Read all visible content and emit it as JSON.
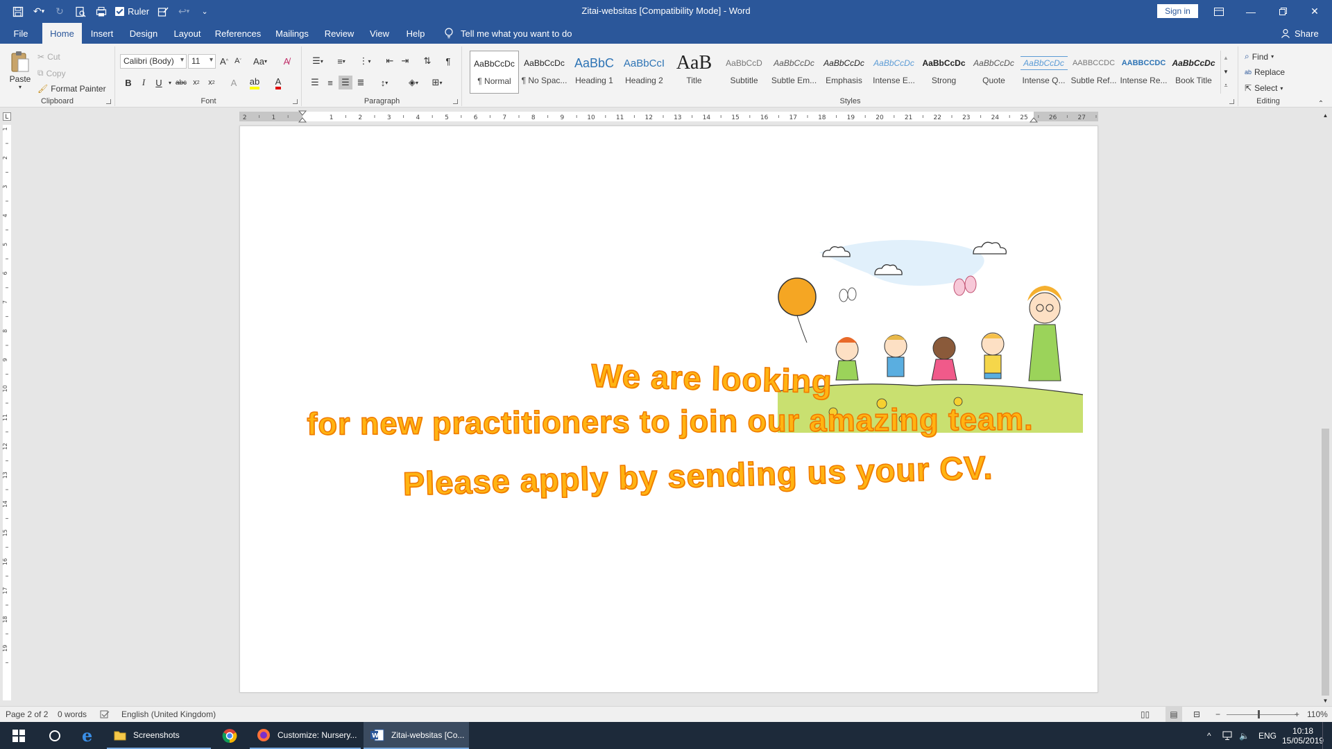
{
  "window": {
    "title": "Zitai-websitas [Compatibility Mode]  -  Word",
    "signin_label": "Sign in",
    "ruler_label": "Ruler"
  },
  "tabs": [
    {
      "label": "File"
    },
    {
      "label": "Home"
    },
    {
      "label": "Insert"
    },
    {
      "label": "Design"
    },
    {
      "label": "Layout"
    },
    {
      "label": "References"
    },
    {
      "label": "Mailings"
    },
    {
      "label": "Review"
    },
    {
      "label": "View"
    },
    {
      "label": "Help"
    }
  ],
  "tell_me": "Tell me what you want to do",
  "share_label": "Share",
  "clipboard": {
    "paste": "Paste",
    "cut": "Cut",
    "copy": "Copy",
    "format_painter": "Format Painter",
    "label": "Clipboard"
  },
  "font": {
    "name": "Calibri (Body)",
    "size": "11",
    "label": "Font",
    "case": "Aa"
  },
  "paragraph": {
    "label": "Paragraph"
  },
  "styles": {
    "label": "Styles",
    "items": [
      {
        "preview": "AaBbCcDc",
        "name": "¶ Normal"
      },
      {
        "preview": "AaBbCcDc",
        "name": "¶ No Spac..."
      },
      {
        "preview": "AaBbC",
        "name": "Heading 1"
      },
      {
        "preview": "AaBbCcI",
        "name": "Heading 2"
      },
      {
        "preview": "AaB",
        "name": "Title"
      },
      {
        "preview": "AaBbCcD",
        "name": "Subtitle"
      },
      {
        "preview": "AaBbCcDc",
        "name": "Subtle Em..."
      },
      {
        "preview": "AaBbCcDc",
        "name": "Emphasis"
      },
      {
        "preview": "AaBbCcDc",
        "name": "Intense E..."
      },
      {
        "preview": "AaBbCcDc",
        "name": "Strong"
      },
      {
        "preview": "AaBbCcDc",
        "name": "Quote"
      },
      {
        "preview": "AaBbCcDc",
        "name": "Intense Q..."
      },
      {
        "preview": "AaBbCcDc",
        "name": "Subtle Ref..."
      },
      {
        "preview": "AaBbCcDc",
        "name": "Intense Re..."
      },
      {
        "preview": "AaBbCcDc",
        "name": "Book Title"
      }
    ]
  },
  "editing": {
    "label": "Editing",
    "find": "Find",
    "replace": "Replace",
    "select": "Select"
  },
  "ruler_numbers": [
    "2",
    "1",
    "1",
    "2",
    "3",
    "4",
    "5",
    "6",
    "7",
    "8",
    "9",
    "10",
    "11",
    "12",
    "13",
    "14",
    "15",
    "16",
    "17",
    "18",
    "19",
    "20",
    "21",
    "22",
    "23",
    "24",
    "25",
    "26",
    "27"
  ],
  "vruler_numbers": [
    "1",
    "2",
    "3",
    "4",
    "5",
    "6",
    "7",
    "8",
    "9",
    "10",
    "11",
    "12",
    "13",
    "14",
    "15",
    "16",
    "17",
    "18",
    "19"
  ],
  "document": {
    "line1": "We are looking",
    "line2": "for new practitioners to join our amazing team.",
    "line3": "Please apply by sending us your CV."
  },
  "status": {
    "page": "Page 2 of 2",
    "words": "0 words",
    "language": "English (United Kingdom)",
    "zoom": "110%"
  },
  "taskbar": {
    "apps": [
      {
        "label": "Screenshots"
      },
      {
        "label": "Customize: Nursery..."
      },
      {
        "label": "Zitai-websitas [Co..."
      }
    ],
    "lang": "ENG",
    "time": "10:18",
    "date": "15/05/2019"
  },
  "colors": {
    "brand": "#2b579a",
    "wordart_fill": "#ffb412",
    "wordart_outline": "#f07800"
  }
}
